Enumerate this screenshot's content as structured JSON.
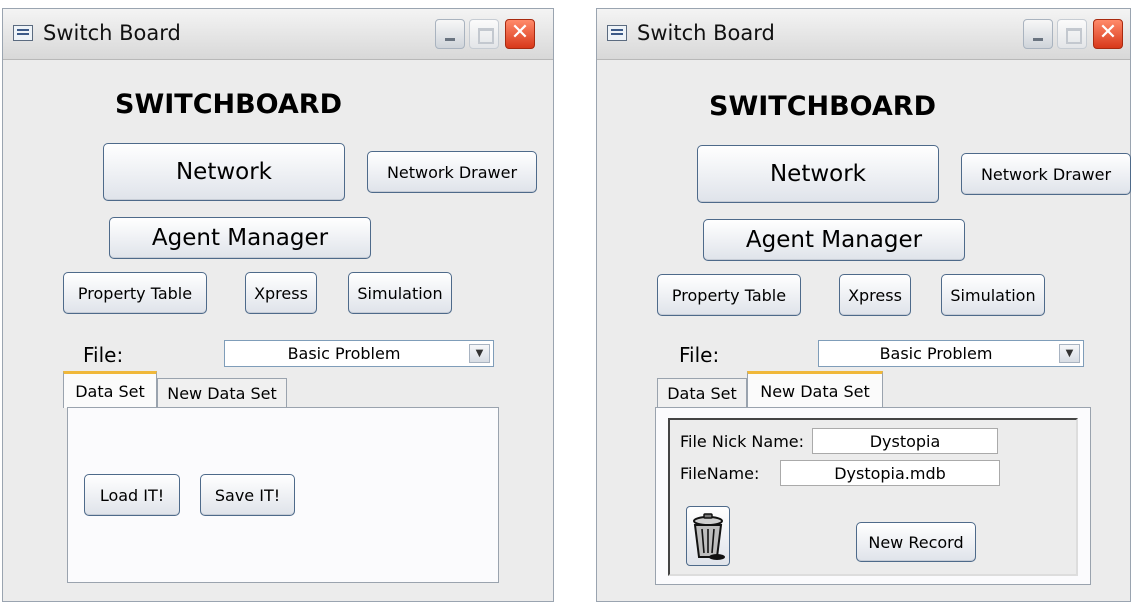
{
  "windows": [
    {
      "title": "Switch Board",
      "heading": "SWITCHBOARD",
      "buttons": {
        "network": "Network",
        "network_drawer": "Network Drawer",
        "agent_manager": "Agent Manager",
        "property_table": "Property Table",
        "xpress": "Xpress",
        "simulation": "Simulation"
      },
      "file_label": "File:",
      "file_value": "Basic Problem",
      "tabs": [
        "Data Set",
        "New Data Set"
      ],
      "active_tab": "Data Set",
      "data_set": {
        "load": "Load IT!",
        "save": "Save IT!"
      }
    },
    {
      "title": "Switch Board",
      "heading": "SWITCHBOARD",
      "buttons": {
        "network": "Network",
        "network_drawer": "Network Drawer",
        "agent_manager": "Agent Manager",
        "property_table": "Property Table",
        "xpress": "Xpress",
        "simulation": "Simulation"
      },
      "file_label": "File:",
      "file_value": "Basic Problem",
      "tabs": [
        "Data Set",
        "New Data Set"
      ],
      "active_tab": "New Data Set",
      "new_data_set": {
        "nick_label": "File Nick Name:",
        "nick_value": "Dystopia",
        "filename_label": "FileName:",
        "filename_value": "Dystopia.mdb",
        "new_record": "New Record"
      }
    }
  ],
  "icons": {
    "window_icon": "form-icon",
    "minimize": "minimize-icon",
    "maximize": "maximize-icon",
    "close": "close-icon",
    "dropdown": "chevron-down-icon",
    "delete": "trash-icon"
  },
  "colors": {
    "close_red": "#d8381a",
    "active_tab": "#f0b83a",
    "button_border": "#4e6a8a"
  }
}
